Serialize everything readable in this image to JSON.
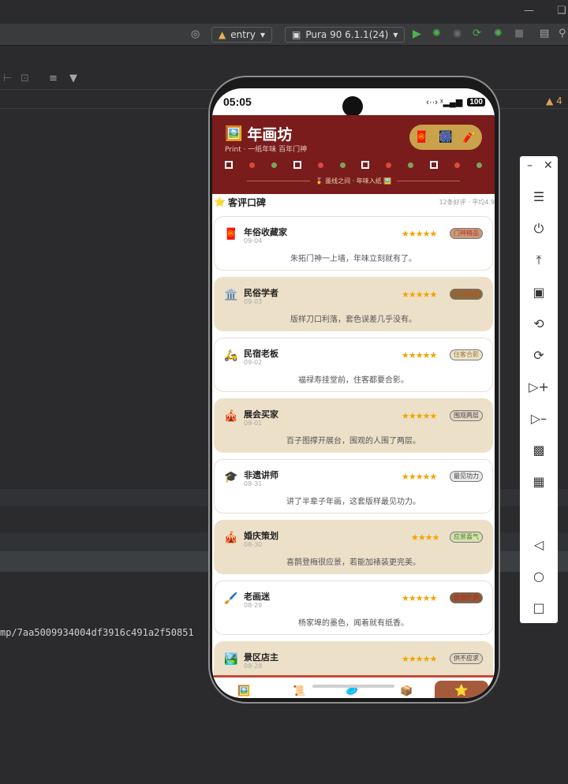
{
  "ide": {
    "run_config": "entry",
    "device": "Pura 90 6.1.1(24)",
    "warning_count": "4",
    "log_text": "mp/7aa5009934004df3916c491a2f50851"
  },
  "phone": {
    "status": {
      "time": "05:05",
      "signal": "‹··› ˣ…⁙",
      "battery": "100"
    },
    "hero": {
      "icon": "🖼️",
      "title": "年画坊",
      "subtitle": "Print · 一纸年味 百年门神",
      "chips": [
        "🧧",
        "🎆",
        "🧨"
      ],
      "tagline": "🎖️ 墨线之间 · 年味入纸 🖼️",
      "pattern_colors": [
        "#ffffff",
        "#d84a3a",
        "#7ea35a",
        "#ffffff",
        "#d84a3a",
        "#7ea35a",
        "#ffffff",
        "#d84a3a",
        "#7ea35a",
        "#ffffff",
        "#d84a3a",
        "#7ea35a"
      ]
    },
    "reviews_section": {
      "title": "客评口碑",
      "meta": "12条好评 · 平均4.9"
    },
    "reviews": [
      {
        "avatar": "🧧",
        "name": "年俗收藏家",
        "date": "09-04",
        "stars": "★★★★★",
        "badge": "门神精品",
        "text": "朱拓门神一上墙，年味立刻就有了。",
        "style": "white",
        "badge_bg": "#c89a7a",
        "badge_fg": "#b3382a"
      },
      {
        "avatar": "🏛️",
        "name": "民俗学者",
        "date": "09-03",
        "stars": "★★★★★",
        "badge": "刀口利落",
        "text": "版样刀口利落，套色误差几乎没有。",
        "style": "beige",
        "badge_bg": "#8a6a3a",
        "badge_fg": "#c0501f"
      },
      {
        "avatar": "🛵",
        "name": "民宿老板",
        "date": "09-02",
        "stars": "★★★★★",
        "badge": "住客合影",
        "text": "福禄寿挂堂前，住客都要合影。",
        "style": "white",
        "badge_bg": "#ece3c9",
        "badge_fg": "#9a7a3a"
      },
      {
        "avatar": "🎪",
        "name": "展会买家",
        "date": "09-01",
        "stars": "★★★★★",
        "badge": "围观两层",
        "text": "百子图撑开展台，围观的人围了两层。",
        "style": "beige",
        "badge_bg": "#e3d8c4",
        "badge_fg": "#444444"
      },
      {
        "avatar": "🎓",
        "name": "非遗讲师",
        "date": "08-31",
        "stars": "★★★★★",
        "badge": "最见功力",
        "text": "讲了半辈子年画，这套版样最见功力。",
        "style": "white",
        "badge_bg": "#e8e8e8",
        "badge_fg": "#444444"
      },
      {
        "avatar": "🎪",
        "name": "婚庆策划",
        "date": "08-30",
        "stars": "★★★★",
        "badge": "应景喜气",
        "text": "喜鹊登梅很应景，若能加裱装更完美。",
        "style": "beige",
        "badge_bg": "#d6e3b4",
        "badge_fg": "#4f7a2a"
      },
      {
        "avatar": "🖌️",
        "name": "老画迷",
        "date": "08-29",
        "stars": "★★★★★",
        "badge": "墨香扑鼻",
        "text": "杨家埠的墨色，闻着就有纸香。",
        "style": "white",
        "badge_bg": "#8a5a3a",
        "badge_fg": "#c0301f"
      },
      {
        "avatar": "🏞️",
        "name": "景区店主",
        "date": "08-28",
        "stars": "★★★★★",
        "badge": "供不应求",
        "text": "",
        "style": "beige",
        "badge_bg": "#e3d8c4",
        "badge_fg": "#444444"
      }
    ],
    "tabs": [
      "🖼️",
      "📜",
      "🥏",
      "📦",
      "⭐"
    ]
  },
  "emulator_controls": [
    "menu-icon",
    "power-icon",
    "pin-top-icon",
    "crop-icon",
    "rotate-left-icon",
    "rotate-right-icon",
    "volume-up-icon",
    "volume-down-icon",
    "shake-icon",
    "screenshot-icon",
    "back-icon",
    "home-icon",
    "recents-icon"
  ]
}
